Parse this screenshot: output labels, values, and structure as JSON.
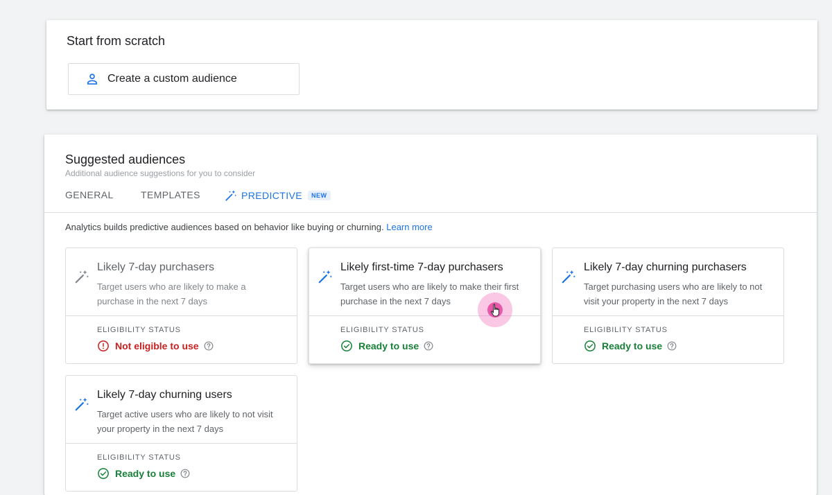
{
  "scratch": {
    "title": "Start from scratch",
    "create_label": "Create a custom audience"
  },
  "suggested": {
    "title": "Suggested audiences",
    "subtitle": "Additional audience suggestions for you to consider",
    "tabs": {
      "general": "GENERAL",
      "templates": "TEMPLATES",
      "predictive": "PREDICTIVE",
      "new_badge": "NEW"
    },
    "description": "Analytics builds predictive audiences based on behavior like buying or churning.",
    "learn_more": "Learn more",
    "eligibility_label": "ELIGIBILITY STATUS",
    "cards": [
      {
        "name": "Likely 7-day purchasers",
        "description": "Target users who are likely to make a purchase in the next 7 days",
        "status": "Not eligible to use"
      },
      {
        "name": "Likely first-time 7-day purchasers",
        "description": "Target users who are likely to make their first purchase in the next 7 days",
        "status": "Ready to use"
      },
      {
        "name": "Likely 7-day churning purchasers",
        "description": "Target purchasing users who are likely to not visit your property in the next 7 days",
        "status": "Ready to use"
      },
      {
        "name": "Likely 7-day churning users",
        "description": "Target active users who are likely to not visit your property in the next 7 days",
        "status": "Ready to use"
      }
    ]
  },
  "colors": {
    "accent": "#1a73e8",
    "ready": "#188038",
    "not_eligible": "#c5221f"
  },
  "icons": {
    "create": "person-icon",
    "predictive": "magic-wand-icon",
    "ready": "check-circle-icon",
    "not_eligible": "error-icon",
    "help": "help-circle-icon"
  }
}
